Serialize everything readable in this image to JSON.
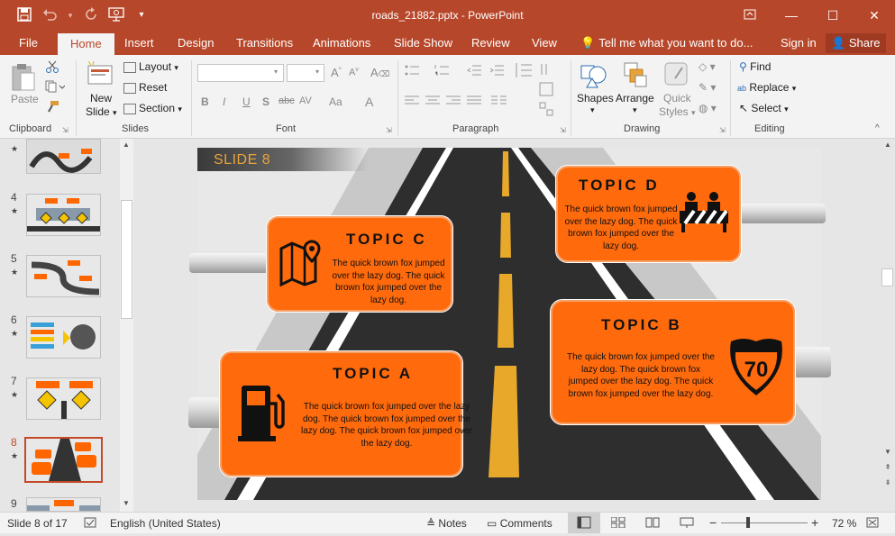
{
  "titlebar": {
    "title": "roads_21882.pptx - PowerPoint",
    "bg": "#b7472a",
    "qat_icons": [
      "save-icon",
      "undo-icon",
      "redo-icon",
      "presenter-icon",
      "customize-icon"
    ],
    "win_icons": [
      "ribbon-display-icon",
      "minimize-icon",
      "maximize-icon",
      "close-icon"
    ]
  },
  "tabs": {
    "file": "File",
    "home": "Home",
    "insert": "Insert",
    "design": "Design",
    "transitions": "Transitions",
    "animations": "Animations",
    "slideshow": "Slide Show",
    "review": "Review",
    "view": "View",
    "tellme": "Tell me what you want to do...",
    "signin": "Sign in",
    "share": "Share"
  },
  "ribbon": {
    "clipboard": {
      "label": "Clipboard",
      "paste": "Paste"
    },
    "slides": {
      "label": "Slides",
      "new_slide_1": "New",
      "new_slide_2": "Slide",
      "layout": "Layout",
      "reset": "Reset",
      "section": "Section"
    },
    "font": {
      "label": "Font",
      "bold": "B",
      "italic": "I",
      "underline": "U",
      "strike": "S",
      "abc": "abc",
      "av": "AV",
      "aa": "Aa",
      "a": "A"
    },
    "paragraph": {
      "label": "Paragraph"
    },
    "drawing": {
      "label": "Drawing",
      "shapes": "Shapes",
      "arrange": "Arrange",
      "quick_styles_1": "Quick",
      "quick_styles_2": "Styles"
    },
    "editing": {
      "label": "Editing",
      "find": "Find",
      "replace": "Replace",
      "select": "Select"
    }
  },
  "thumbnails": [
    {
      "num": "",
      "top": 0
    },
    {
      "num": "4"
    },
    {
      "num": "5"
    },
    {
      "num": "6"
    },
    {
      "num": "7"
    },
    {
      "num": "8"
    },
    {
      "num": "9"
    }
  ],
  "slide": {
    "label": "SLIDE 8",
    "topic_a": {
      "title": "TOPIC A",
      "text": "The quick brown fox jumped over the lazy dog. The quick brown fox jumped over the lazy dog. The quick brown fox jumped over the lazy dog."
    },
    "topic_b": {
      "title": "TOPIC B",
      "text": "The quick brown fox jumped over the lazy dog. The quick brown fox jumped over the lazy dog. The quick brown fox jumped over the lazy dog."
    },
    "topic_c": {
      "title": "TOPIC C",
      "text": "The quick brown fox jumped over the lazy dog. The quick brown fox jumped over the lazy dog."
    },
    "topic_d": {
      "title": "TOPIC D",
      "text": "The quick brown fox jumped over the lazy dog. The quick brown fox jumped over the lazy dog."
    },
    "sign_number": "70",
    "colors": {
      "card": "#ff6a0d",
      "road": "#2e2e2e",
      "lane": "#e8a82a"
    }
  },
  "status": {
    "slide_of": "Slide 8 of 17",
    "language": "English (United States)",
    "notes": "Notes",
    "comments": "Comments",
    "zoom": "72 %"
  }
}
